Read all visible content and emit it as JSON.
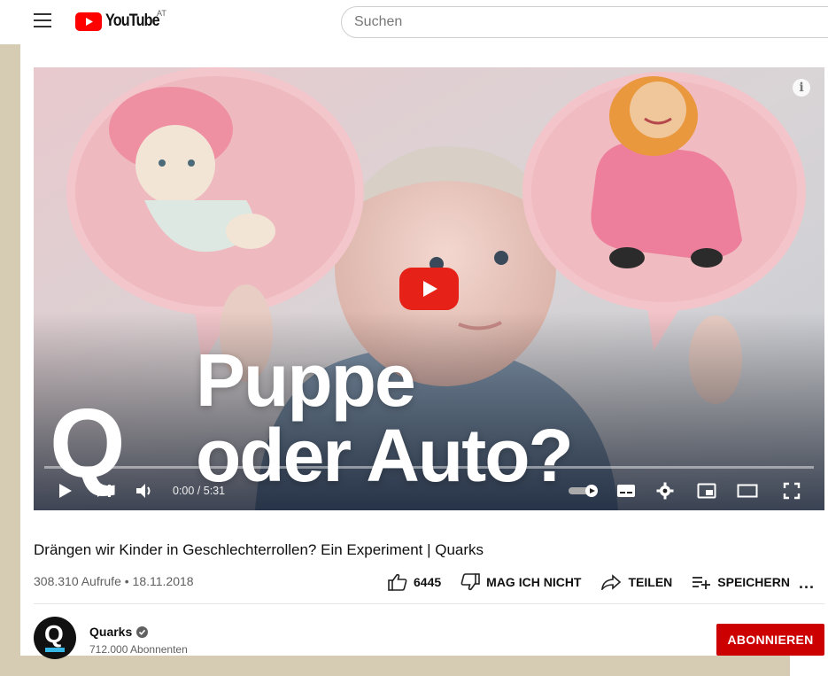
{
  "header": {
    "logo_text": "YouTube",
    "region": "AT",
    "search_placeholder": "Suchen"
  },
  "video": {
    "thumbnail_title_line1": "Puppe",
    "thumbnail_title_line2": "oder Auto?",
    "thumbnail_logo": "Q",
    "time": "0:00 / 5:31",
    "info_glyph": "i"
  },
  "meta": {
    "title": "Drängen wir Kinder in Geschlechterrollen? Ein Experiment | Quarks",
    "views": "308.310 Aufrufe • 18.11.2018",
    "like_count": "6445",
    "dislike_label": "MAG ICH NICHT",
    "share_label": "TEILEN",
    "save_label": "SPEICHERN",
    "more": "..."
  },
  "channel": {
    "avatar_letter": "Q",
    "name": "Quarks",
    "subscribers": "712.000 Abonnenten",
    "subscribe_label": "ABONNIEREN"
  },
  "colors": {
    "brand_red": "#ff0000",
    "subscribe_red": "#cc0000",
    "play_red": "#e62117",
    "frame": "#d6ccb4"
  }
}
